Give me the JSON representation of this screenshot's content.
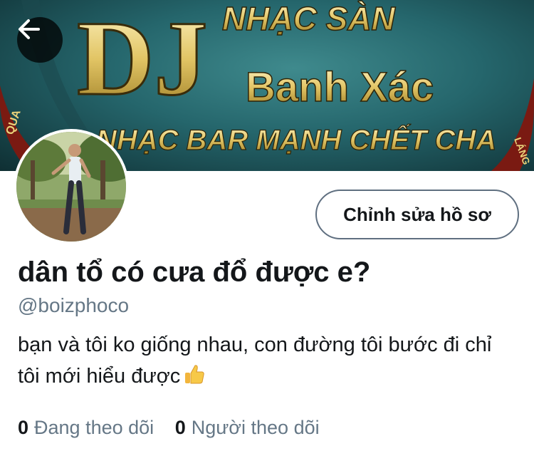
{
  "banner": {
    "line1": "NHẠC SÀN",
    "line2": "Banh Xác",
    "line3": "NHẠC BAR MẠNH CHẾT CHA",
    "dj": "DJ",
    "badge_left": "QUA",
    "badge_right": "LÁNG"
  },
  "header": {
    "back_icon": "arrow-left-icon"
  },
  "profile": {
    "edit_label": "Chỉnh sửa hồ sơ",
    "display_name": "dân tổ có cưa đổ được e?",
    "handle": "@boizphoco",
    "bio": "bạn và tôi ko giống nhau, con đường tôi bước đi chỉ tôi mới hiểu được",
    "bio_emoji": "thumbs-up-icon"
  },
  "stats": {
    "following_count": "0",
    "following_label": "Đang theo dõi",
    "followers_count": "0",
    "followers_label": "Người theo dõi"
  },
  "colors": {
    "text": "#14171a",
    "muted": "#657786",
    "border": "#5f6f80"
  }
}
